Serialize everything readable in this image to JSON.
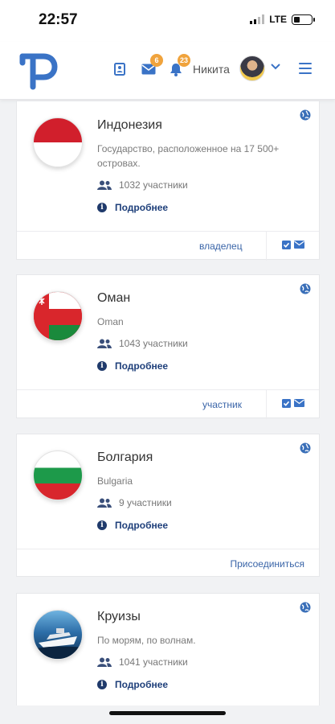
{
  "status": {
    "time": "22:57",
    "network": "LTE",
    "battery_level": 0.35
  },
  "header": {
    "messages_badge": "6",
    "notifications_badge": "23",
    "user_name": "Никита"
  },
  "colors": {
    "accent": "#3a73c6",
    "badge": "#f0a33c",
    "link": "#3a65a8",
    "more_link": "#1e3f7a"
  },
  "cards": [
    {
      "title": "Индонезия",
      "description": "Государство, расположенное на 17 500+ островах.",
      "members": "1032 участники",
      "more": "Подробнее",
      "role": "владелец",
      "flag": "indonesia-flag"
    },
    {
      "title": "Оман",
      "description": "Oman",
      "members": "1043 участники",
      "more": "Подробнее",
      "role": "участник",
      "flag": "oman-flag"
    },
    {
      "title": "Болгария",
      "description": "Bulgaria",
      "members": "9 участники",
      "more": "Подробнее",
      "join": "Присоединиться",
      "flag": "bulgaria-flag"
    },
    {
      "title": "Круизы",
      "description": "По морям, по волнам.",
      "members": "1041 участники",
      "more": "Подробнее",
      "flag": "cruise-image"
    }
  ]
}
